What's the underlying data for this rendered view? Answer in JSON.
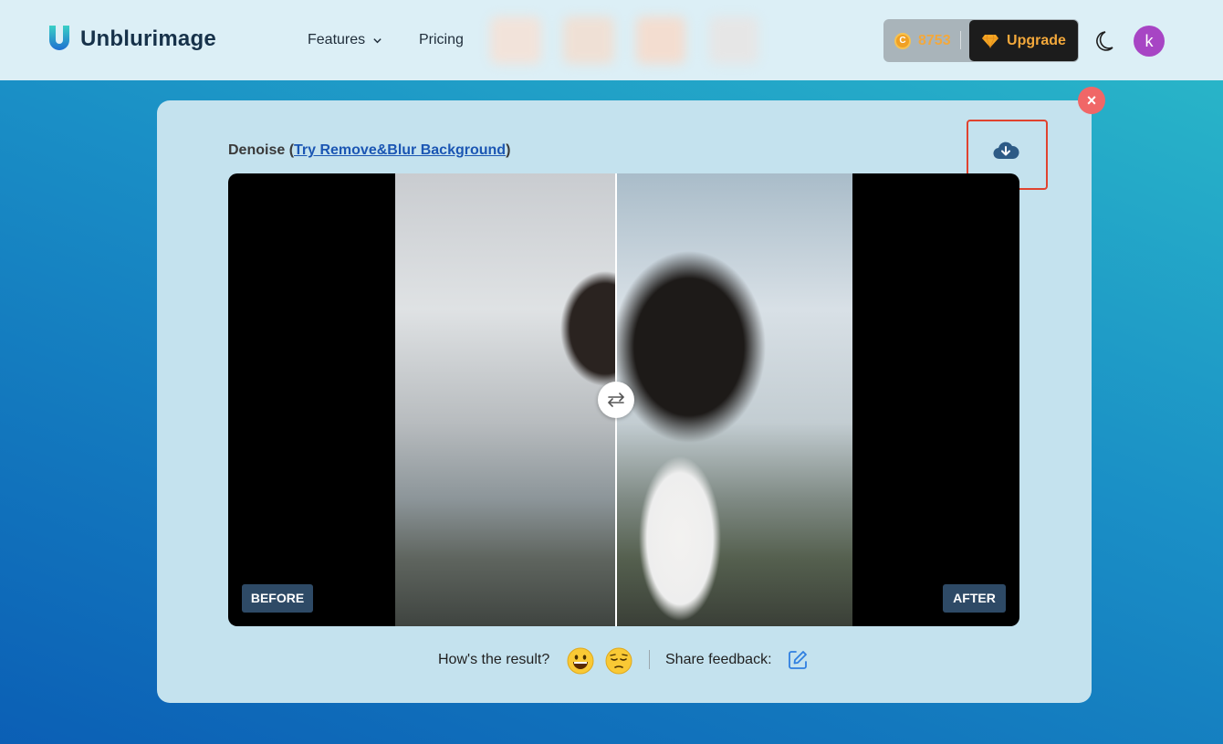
{
  "header": {
    "brand": "Unblurimage",
    "nav": {
      "features": "Features",
      "pricing": "Pricing"
    },
    "credits": "8753",
    "coin_glyph": "C",
    "upgrade_label": "Upgrade",
    "avatar_initial": "k"
  },
  "modal": {
    "close_glyph": "×",
    "title_prefix": "Denoise (",
    "title_link": "Try Remove&Blur Background",
    "title_suffix": ")",
    "before_label": "BEFORE",
    "after_label": "AFTER",
    "feedback_question": "How's the result?",
    "share_feedback": "Share feedback:"
  },
  "colors": {
    "accent_blue": "#1b56b3",
    "gold": "#f3a83b",
    "close_red": "#f06767",
    "avatar_purple": "#a745c4",
    "badge_navy": "#2e4a66"
  },
  "icons": [
    "logo-icon",
    "chevron-down-icon",
    "coin-icon",
    "gem-icon",
    "moon-icon",
    "close-icon",
    "cloud-download-icon",
    "swap-arrows-icon",
    "grinning-face-icon",
    "pensive-face-icon",
    "edit-icon"
  ]
}
